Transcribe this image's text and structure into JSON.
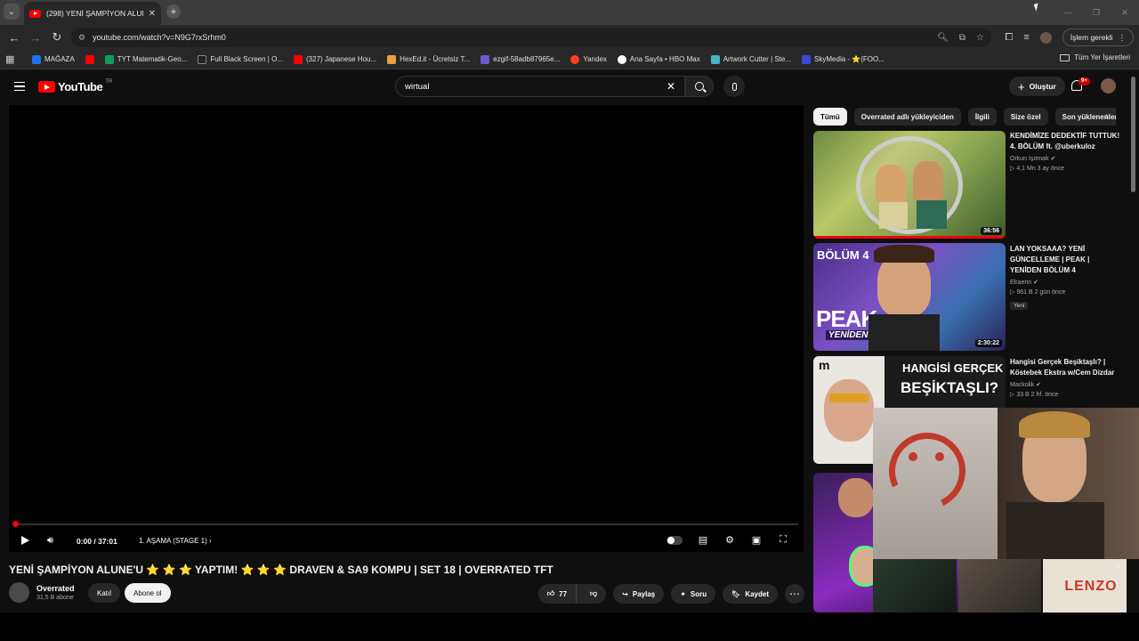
{
  "browser": {
    "tab_title": "(298) YENİ ŞAMPİYON ALUNE'U",
    "url": "youtube.com/watch?v=N9G7rxSrhm0",
    "action_label": "İşlem gerekli",
    "bookmarks": [
      {
        "label": "MAĞAZA",
        "color": "#1a73e8"
      },
      {
        "label": "",
        "color": "#ff0000"
      },
      {
        "label": "TYT Matematik-Geo...",
        "color": "#0f9d58"
      },
      {
        "label": "Full Black Screen | O...",
        "color": "#222222"
      },
      {
        "label": "(327) Japanese Hou...",
        "color": "#ff0000"
      },
      {
        "label": "HexEd.it - Ücretsiz T...",
        "color": "#e8a33d"
      },
      {
        "label": "ezgif-58adb87965e...",
        "color": "#6a5acd"
      },
      {
        "label": "Yandex",
        "color": "#fc3f1d"
      },
      {
        "label": "Ana Sayfa • HBO Max",
        "color": "#ffffff"
      },
      {
        "label": "Artwork Cutter | Ste...",
        "color": "#4ab0c4"
      },
      {
        "label": "SkyMedia - ⭐(FOO...",
        "color": "#3a49d6"
      }
    ],
    "all_bookmarks": "Tüm Yer İşaretleri"
  },
  "youtube": {
    "logo_text": "YouTube",
    "logo_region": "TR",
    "search_value": "wirtual",
    "create_label": "Oluştur",
    "notif_count": "9+"
  },
  "player": {
    "time": "0:00 / 37:01",
    "chapter": "1. AŞAMA (STAGE 1)"
  },
  "video": {
    "title": "YENİ ŞAMPİYON ALUNE'U ⭐ ⭐ ⭐ YAPTIM! ⭐ ⭐ ⭐ DRAVEN & SA9 KOMPU | SET 18 | OVERRATED TFT",
    "channel": "Overrated",
    "subscribers": "31,5 B abone",
    "join_label": "Katıl",
    "subscribe_label": "Abone ol",
    "likes": "77",
    "share_label": "Paylaş",
    "ask_label": "Soru",
    "save_label": "Kaydet"
  },
  "chips": [
    "Tümü",
    "Overrated adlı yükleyiciden",
    "İlgili",
    "Size özel",
    "Son yüklenenler"
  ],
  "related": [
    {
      "title": "KENDİMİZE DEDEKTİF TUTTUK! 4. BÖLÜM ft. @uberkuloz",
      "channel": "Orkun Işıtmak ✔",
      "stats": "▷ 4,1 Mn   3 ay önce",
      "duration": "36:56"
    },
    {
      "title": "LAN YOKSAAA? YENİ GÜNCELLEME | PEAK | YENİDEN BÖLÜM 4",
      "channel": "Elraenn ✔",
      "stats": "▷ 961 B   2 gün önce",
      "duration": "2:30:22",
      "badge": "Yeni",
      "thumb_text_1": "BÖLÜM 4",
      "thumb_text_2": "PEAK",
      "thumb_text_3": "YENİDEN"
    },
    {
      "title": "Hangisi Gerçek Beşiktaşlı? | Köstebek Ekstra w/Cem Dizdar",
      "channel": "Mackolik ✔",
      "stats": "▷ 33 B   2 hf. önce",
      "thumb_text_1": "HANGİSİ GERÇEK",
      "thumb_text_2": "BEŞİKTAŞLI?",
      "thumb_logo": "m"
    }
  ],
  "miniplayer": {
    "strip_text": "LENZO"
  }
}
